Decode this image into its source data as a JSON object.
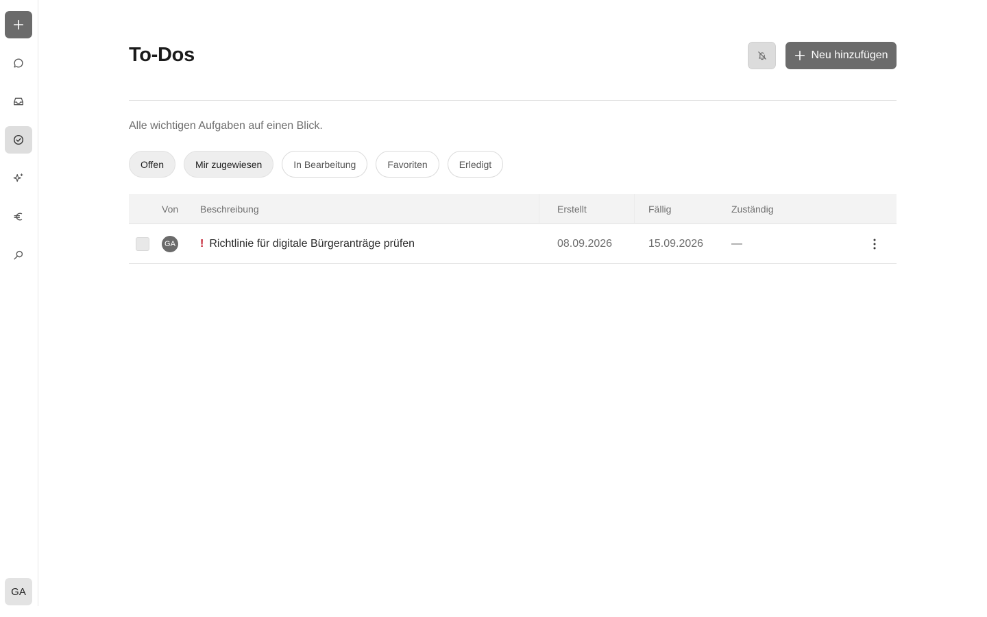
{
  "sidebar": {
    "items": [
      {
        "name": "new-button",
        "icon": "plus-icon"
      },
      {
        "name": "chat",
        "icon": "chat-bubble-icon"
      },
      {
        "name": "inbox",
        "icon": "inbox-icon"
      },
      {
        "name": "todos",
        "icon": "check-circle-icon"
      },
      {
        "name": "ai-assistant",
        "icon": "sparkles-icon"
      },
      {
        "name": "finance",
        "icon": "euro-icon"
      },
      {
        "name": "search",
        "icon": "search-icon"
      }
    ],
    "avatar_initials": "GA"
  },
  "header": {
    "title": "To-Dos",
    "notifications_icon": "bell-off-icon",
    "add_button_label": "Neu hinzufügen"
  },
  "subtitle": "Alle wichtigen Aufgaben auf einen Blick.",
  "filters": [
    {
      "label": "Offen",
      "selected": true
    },
    {
      "label": "Mir zugewiesen",
      "selected": true
    },
    {
      "label": "In Bearbeitung",
      "selected": false
    },
    {
      "label": "Favoriten",
      "selected": false
    },
    {
      "label": "Erledigt",
      "selected": false
    }
  ],
  "table": {
    "columns": {
      "from": "Von",
      "description": "Beschreibung",
      "created": "Erstellt",
      "due": "Fällig",
      "assignee": "Zuständig"
    },
    "rows": [
      {
        "from_initials": "GA",
        "priority_marker": "!",
        "description": "Richtlinie für digitale Bürgeranträge prüfen",
        "created": "08.09.2026",
        "due": "15.09.2026",
        "assignee": "—"
      }
    ]
  },
  "colors": {
    "accent": "#6b6b6b",
    "priority": "#c0192b"
  }
}
